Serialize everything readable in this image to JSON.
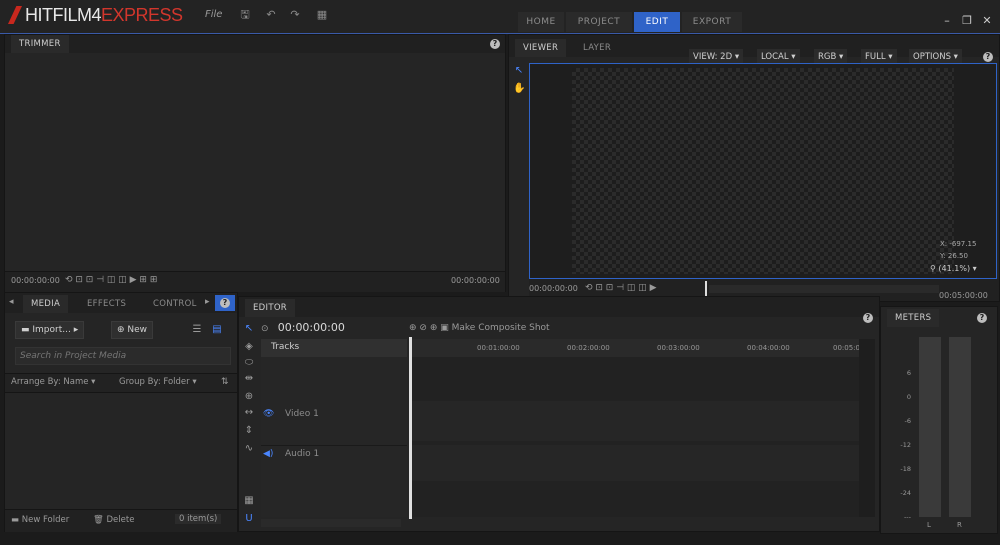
{
  "app": {
    "logo_main": "HITFILM",
    "logo_num": "4",
    "logo_express": "EXPRESS",
    "file_menu": "File"
  },
  "workspace_tabs": [
    "HOME",
    "PROJECT",
    "EDIT",
    "EXPORT"
  ],
  "active_tab": "EDIT",
  "trimmer": {
    "tab": "TRIMMER",
    "timecode_left": "00:00:00:00",
    "timecode_right": "00:00:00:00"
  },
  "viewer": {
    "tabs": [
      "VIEWER",
      "LAYER"
    ],
    "view": "VIEW: 2D",
    "space": "LOCAL",
    "channel": "RGB",
    "quality": "FULL",
    "options": "OPTIONS",
    "x_readout": "X:  -697.15",
    "y_readout": "Y:    26.50",
    "zoom": "(41.1%)",
    "timecode_left": "00:00:00:00",
    "timecode_right": "00:05:00:00"
  },
  "media": {
    "tabs": [
      "MEDIA",
      "EFFECTS",
      "CONTROL"
    ],
    "import_label": "Import...",
    "new_label": "New",
    "search_placeholder": "Search in Project Media",
    "arrange": "Arrange By: Name",
    "group": "Group By: Folder",
    "new_folder": "New Folder",
    "delete": "Delete",
    "count": "0 item(s)"
  },
  "editor": {
    "tab": "EDITOR",
    "timecode": "00:00:00:00",
    "composite": "Make Composite Shot",
    "tracks_label": "Tracks",
    "ruler": [
      "00:01:00:00",
      "00:02:00:00",
      "00:03:00:00",
      "00:04:00:00",
      "00:05:0"
    ],
    "video_track": "Video 1",
    "audio_track": "Audio 1"
  },
  "meters": {
    "tab": "METERS",
    "scale": [
      "6",
      "0",
      "-6",
      "-12",
      "-18",
      "-24",
      "---"
    ],
    "left": "L",
    "right": "R"
  }
}
